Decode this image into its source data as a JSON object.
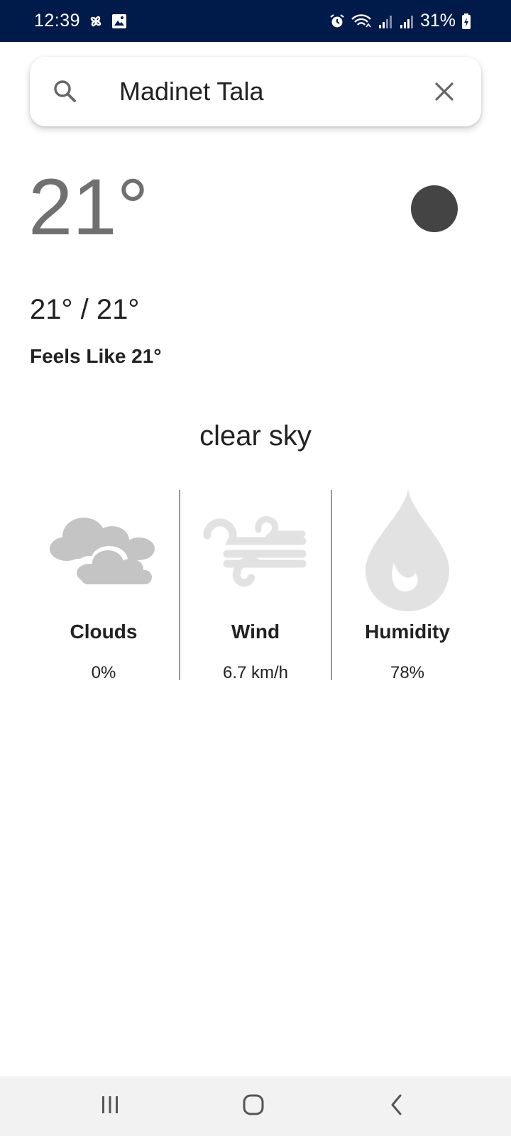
{
  "status_bar": {
    "time": "12:39",
    "battery_percent": "31%",
    "left_icons": [
      "pinwheel-icon",
      "image-icon"
    ],
    "right_icons": [
      "alarm-icon",
      "wifi-icon",
      "signal-icon",
      "signal-icon",
      "battery-charging-icon"
    ],
    "background": "#001a4a"
  },
  "search": {
    "value": "Madinet Tala",
    "icon": "search-icon",
    "clear_icon": "close-icon"
  },
  "weather": {
    "temperature": "21°",
    "min_max": "21° / 21°",
    "feels_like": "Feels Like 21°",
    "description": "clear sky",
    "indicator_color": "#444444"
  },
  "stats": [
    {
      "label": "Clouds",
      "value": "0%",
      "icon": "clouds-icon"
    },
    {
      "label": "Wind",
      "value": "6.7 km/h",
      "icon": "wind-icon"
    },
    {
      "label": "Humidity",
      "value": "78%",
      "icon": "droplet-icon"
    }
  ],
  "nav": {
    "icons": [
      "recent-apps-icon",
      "home-icon",
      "back-icon"
    ]
  }
}
